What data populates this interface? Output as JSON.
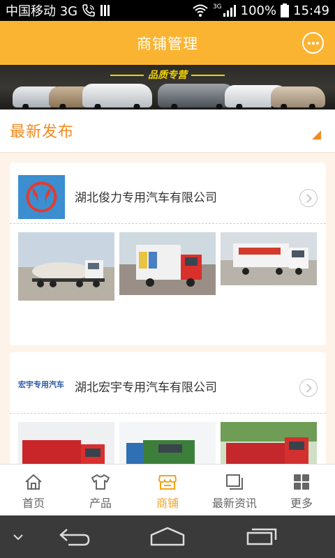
{
  "status_bar": {
    "carrier": "中国移动 3G",
    "network": "3G",
    "battery": "100%",
    "time": "15:49",
    "icons": [
      "phone-icon",
      "signal-bars-icon",
      "wifi-icon",
      "cell-signal-icon",
      "battery-icon"
    ]
  },
  "header": {
    "title": "商铺管理",
    "message_icon": "chat-bubble-icon"
  },
  "banner": {
    "text": "品质专营"
  },
  "section": {
    "title": "最新发布"
  },
  "companies": [
    {
      "name": "湖北俊力专用汽车有限公司",
      "logo": "dongfeng-logo",
      "thumbnails": [
        "tanker-truck",
        "box-truck",
        "bulk-feed-truck"
      ]
    },
    {
      "name": "湖北宏宇专用汽车有限公司",
      "logo_text": "宏宇专用汽车",
      "thumbnails": [
        "red-dump-truck",
        "green-dump-truck",
        "red-dump-truck-2"
      ]
    }
  ],
  "bottom_nav": [
    {
      "label": "首页",
      "icon": "home-icon",
      "active": false
    },
    {
      "label": "产品",
      "icon": "shirt-icon",
      "active": false
    },
    {
      "label": "商铺",
      "icon": "store-icon",
      "active": true
    },
    {
      "label": "最新资讯",
      "icon": "news-icon",
      "active": false
    },
    {
      "label": "更多",
      "icon": "grid-icon",
      "active": false
    }
  ],
  "colors": {
    "accent": "#fbb432",
    "section_orange": "#f28a1f",
    "active_nav": "#f5a31a"
  }
}
